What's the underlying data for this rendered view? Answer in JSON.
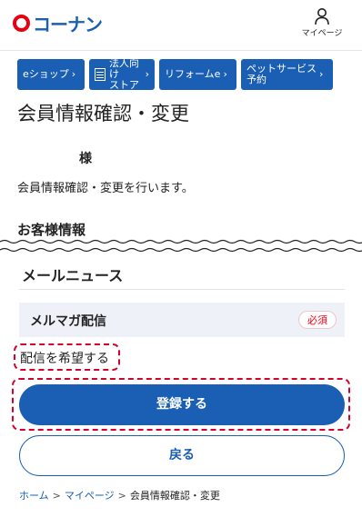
{
  "header": {
    "logo_text": "コーナン",
    "mypage_label": "マイページ"
  },
  "nav": [
    {
      "label": "eショップ",
      "icon": "none"
    },
    {
      "label": "法人向け\nストア",
      "icon": "building-icon"
    },
    {
      "label": "リフォームe",
      "icon": "none"
    },
    {
      "label": "ペットサービス\n予約",
      "icon": "none"
    }
  ],
  "page": {
    "title": "会員情報確認・変更",
    "sama": "様",
    "description": "会員情報確認・変更を行います。",
    "section_customer": "お客様情報"
  },
  "mail_news": {
    "title": "メールニュース",
    "field_label": "メルマガ配信",
    "required_badge": "必須",
    "option_label": "配信を希望する"
  },
  "buttons": {
    "submit": "登録する",
    "back": "戻る"
  },
  "breadcrumb": {
    "home": "ホーム",
    "mypage": "マイページ",
    "current": "会員情報確認・変更",
    "separator": ">"
  },
  "colors": {
    "brand_blue": "#1a5fb4",
    "brand_red": "#e60012",
    "highlight_red": "#d6002a"
  }
}
